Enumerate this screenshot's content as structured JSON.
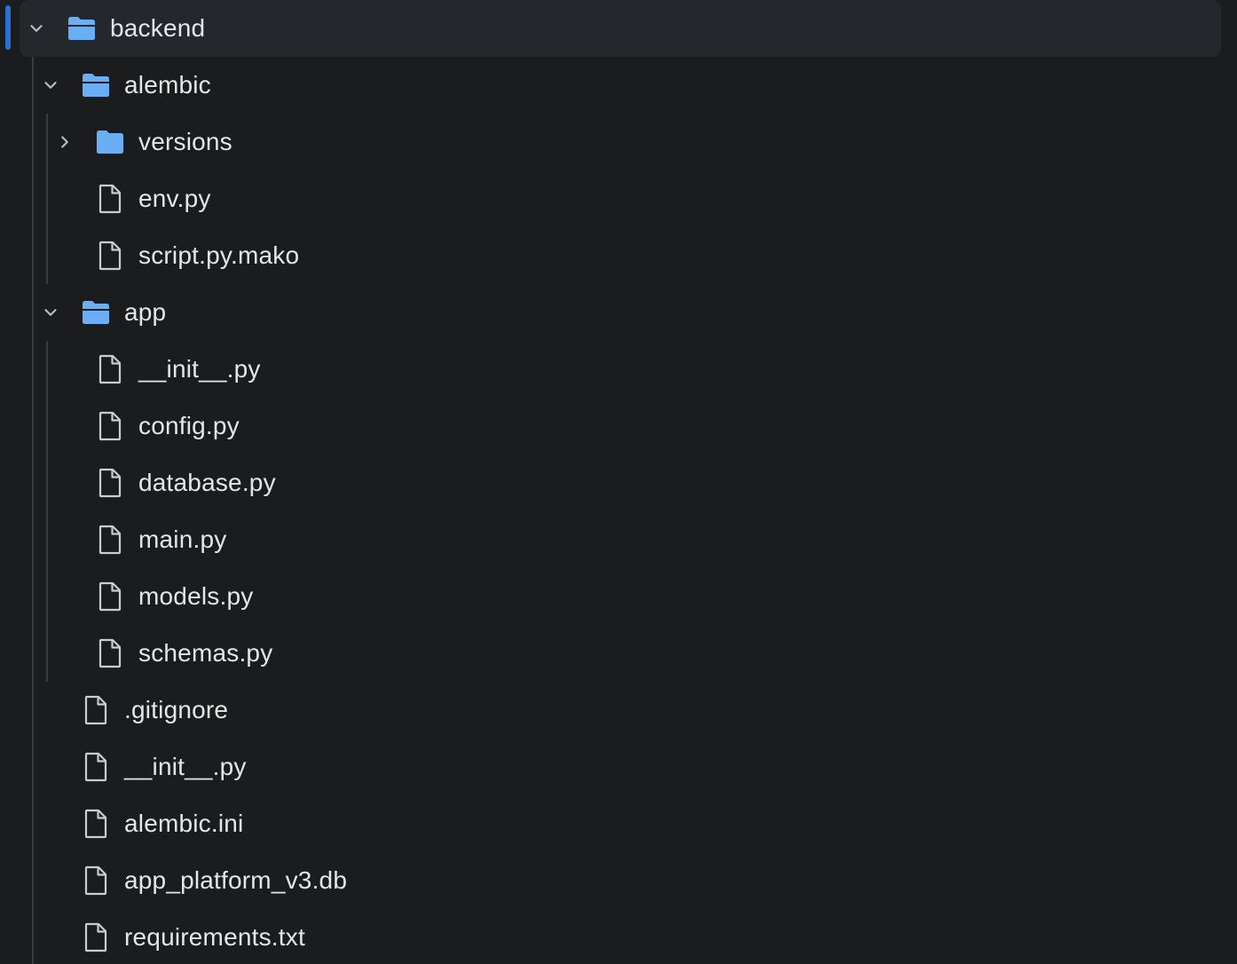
{
  "tree": {
    "items": [
      {
        "label": "backend",
        "kind": "folder",
        "state": "expanded",
        "depth": 0,
        "selected": true
      },
      {
        "label": "alembic",
        "kind": "folder",
        "state": "expanded",
        "depth": 1
      },
      {
        "label": "versions",
        "kind": "folder",
        "state": "collapsed",
        "depth": 2
      },
      {
        "label": "env.py",
        "kind": "file",
        "depth": 2
      },
      {
        "label": "script.py.mako",
        "kind": "file",
        "depth": 2
      },
      {
        "label": "app",
        "kind": "folder",
        "state": "expanded",
        "depth": 1
      },
      {
        "label": "__init__.py",
        "kind": "file",
        "depth": 2
      },
      {
        "label": "config.py",
        "kind": "file",
        "depth": 2
      },
      {
        "label": "database.py",
        "kind": "file",
        "depth": 2
      },
      {
        "label": "main.py",
        "kind": "file",
        "depth": 2
      },
      {
        "label": "models.py",
        "kind": "file",
        "depth": 2
      },
      {
        "label": "schemas.py",
        "kind": "file",
        "depth": 2
      },
      {
        "label": ".gitignore",
        "kind": "file",
        "depth": 1
      },
      {
        "label": "__init__.py",
        "kind": "file",
        "depth": 1
      },
      {
        "label": "alembic.ini",
        "kind": "file",
        "depth": 1
      },
      {
        "label": "app_platform_v3.db",
        "kind": "file",
        "depth": 1
      },
      {
        "label": "requirements.txt",
        "kind": "file",
        "depth": 1
      }
    ]
  },
  "colors": {
    "background": "#1b1c1e",
    "selected_row": "#24272b",
    "active_indicator": "#2e6fd6",
    "folder": "#6aaef5",
    "file_icon": "#c9ccd1",
    "text": "#e4e6ea",
    "chevron": "#b9bcc2"
  },
  "icons": {
    "expanded": "chevron-down-icon",
    "collapsed": "chevron-right-icon",
    "folder_open": "folder-open-icon",
    "folder_closed": "folder-icon",
    "file": "file-icon"
  }
}
